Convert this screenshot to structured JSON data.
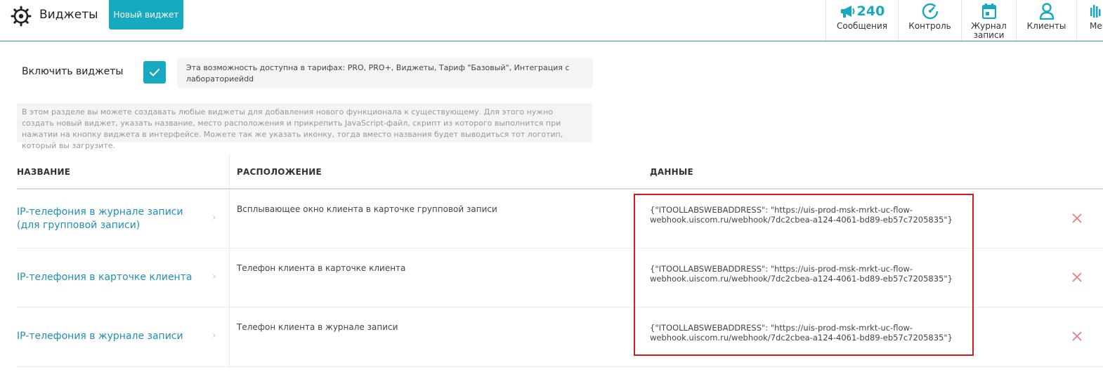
{
  "header": {
    "title": "Виджеты",
    "new_widget_label": "Новый виджет"
  },
  "nav": {
    "messages": {
      "count": "240",
      "label": "Сообщения"
    },
    "control": {
      "label": "Контроль"
    },
    "journal": {
      "label_line1": "Журнал",
      "label_line2": "записи"
    },
    "clients": {
      "label": "Клиенты"
    },
    "menu": {
      "label": "Мен"
    }
  },
  "settings": {
    "enable_label": "Включить виджеты",
    "enabled": true,
    "tariff_note": "Эта возможность доступна в тарифах: PRO, PRO+, Виджеты, Тариф \"Базовый\", Интеграция с лабораториейdd",
    "info_text": "В этом разделе вы можете создавать любые виджеты для добавления нового функционала к существующему. Для этого нужно создать новый виджет, указать название, место расположения и прикрепить JavaScript-файл, скрипт из которого выполнится при нажатии на кнопку виджета в интерфейсе. Можете так же указать иконку, тогда вместо названия будет выводиться тот логотип, который вы загрузите."
  },
  "table": {
    "columns": {
      "name": "НАЗВАНИЕ",
      "location": "РАСПОЛОЖЕНИЕ",
      "data": "ДАННЫЕ"
    },
    "rows": [
      {
        "name_line1": "IP-телефония в журнале записи",
        "name_line2": "(для групповой записи)",
        "location": "Всплывающее окно клиента в карточке групповой записи",
        "data_line1": "{\"ITOOLLABSWEBADDRESS\": \"https://uis-prod-msk-mrkt-uc-flow-",
        "data_line2": "webhook.uiscom.ru/webhook/7dc2cbea-a124-4061-bd89-eb57c7205835\"}"
      },
      {
        "name_line1": "IP-телефония в карточке клиента",
        "location": "Телефон клиента в карточке клиента",
        "data_line1": "{\"ITOOLLABSWEBADDRESS\": \"https://uis-prod-msk-mrkt-uc-flow-",
        "data_line2": "webhook.uiscom.ru/webhook/7dc2cbea-a124-4061-bd89-eb57c7205835\"}"
      },
      {
        "name_line1": "IP-телефония в журнале записи",
        "location": "Телефон клиента в журнале записи",
        "data_line1": "{\"ITOOLLABSWEBADDRESS\": \"https://uis-prod-msk-mrkt-uc-flow-",
        "data_line2": "webhook.uiscom.ru/webhook/7dc2cbea-a124-4061-bd89-eb57c7205835\"}"
      }
    ]
  },
  "colors": {
    "accent": "#17a9bf",
    "link": "#1f8fb5",
    "delete": "#e8777b",
    "highlight": "#d6191e"
  }
}
